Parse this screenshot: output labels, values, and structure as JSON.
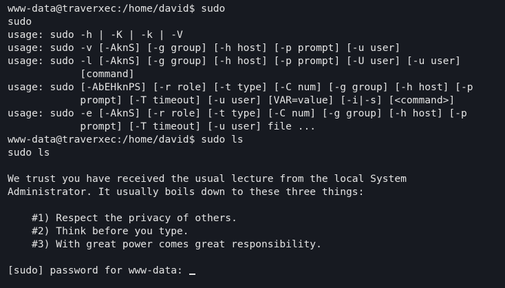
{
  "terminal": {
    "lines": [
      "www-data@traverxec:/home/david$ sudo",
      "sudo",
      "usage: sudo -h | -K | -k | -V",
      "usage: sudo -v [-AknS] [-g group] [-h host] [-p prompt] [-u user]",
      "usage: sudo -l [-AknS] [-g group] [-h host] [-p prompt] [-U user] [-u user]",
      "            [command]",
      "usage: sudo [-AbEHknPS] [-r role] [-t type] [-C num] [-g group] [-h host] [-p",
      "            prompt] [-T timeout] [-u user] [VAR=value] [-i|-s] [<command>]",
      "usage: sudo -e [-AknS] [-r role] [-t type] [-C num] [-g group] [-h host] [-p",
      "            prompt] [-T timeout] [-u user] file ...",
      "www-data@traverxec:/home/david$ sudo ls",
      "sudo ls",
      "",
      "We trust you have received the usual lecture from the local System",
      "Administrator. It usually boils down to these three things:",
      "",
      "    #1) Respect the privacy of others.",
      "    #2) Think before you type.",
      "    #3) With great power comes great responsibility.",
      "",
      "[sudo] password for www-data: "
    ],
    "text_color": "#e4e4e4",
    "background_color": "#171a21"
  }
}
